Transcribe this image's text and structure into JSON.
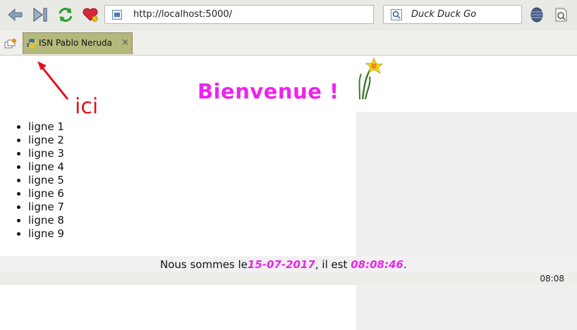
{
  "browser": {
    "url": "http://localhost:5000/",
    "search_engine": "Duck Duck Go",
    "tab_title": "ISN Pablo Neruda",
    "tab_close": "×"
  },
  "annotation": {
    "label": "ici",
    "color": "#e0141c"
  },
  "page": {
    "title": "Bienvenue !",
    "title_color": "#ee22ee",
    "items": [
      "ligne 1",
      "ligne 2",
      "ligne 3",
      "ligne 4",
      "ligne 5",
      "ligne 6",
      "ligne 7",
      "ligne 8",
      "ligne 9"
    ],
    "footer_prefix": "Nous sommes le",
    "date": "15-07-2017",
    "footer_middle": ", il est ",
    "time": "08:08:46",
    "footer_suffix": "."
  },
  "statusbar": {
    "clock": "08:08"
  },
  "icons": [
    "back-icon",
    "forward-end-icon",
    "reload-icon",
    "bookmark-heart-icon",
    "page-favicon",
    "search-icon",
    "globe-icon",
    "tools-icon",
    "python-logo-icon",
    "daffodil-icon",
    "new-tab-icon",
    "annotation-arrow-icon"
  ]
}
